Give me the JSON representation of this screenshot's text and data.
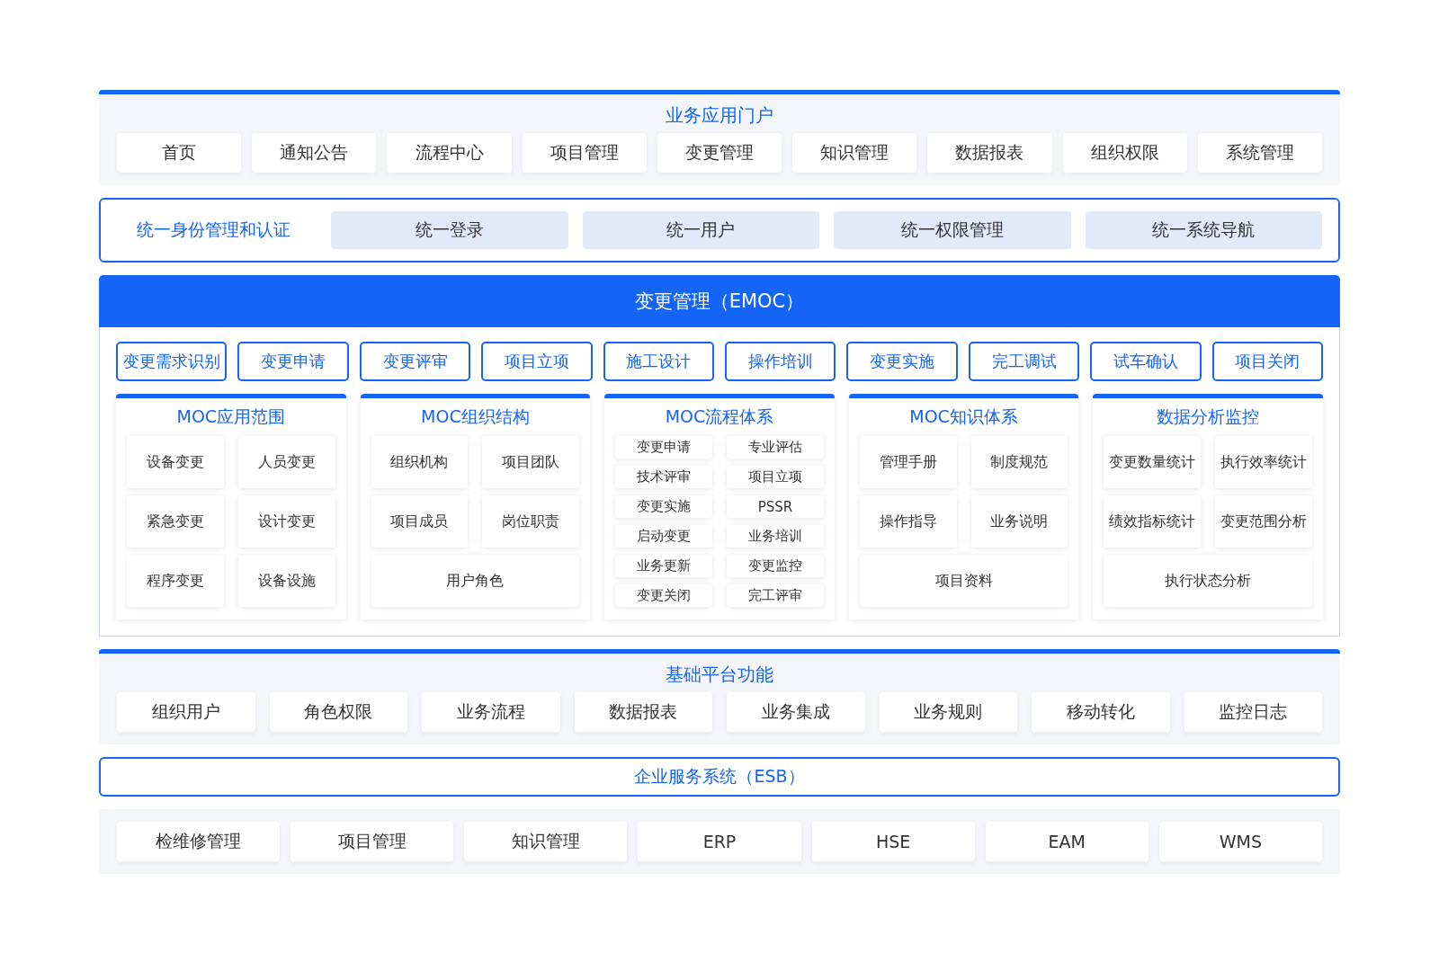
{
  "portal": {
    "title": "业务应用门户",
    "items": [
      "首页",
      "通知公告",
      "流程中心",
      "项目管理",
      "变更管理",
      "知识管理",
      "数据报表",
      "组织权限",
      "系统管理"
    ]
  },
  "identity": {
    "label": "统一身份管理和认证",
    "items": [
      "统一登录",
      "统一用户",
      "统一权限管理",
      "统一系统导航"
    ]
  },
  "emoc": {
    "title": "变更管理（EMOC）",
    "steps": [
      "变更需求识别",
      "变更申请",
      "变更评审",
      "项目立项",
      "施工设计",
      "操作培训",
      "变更实施",
      "完工调试",
      "试车确认",
      "项目关闭"
    ],
    "modules": [
      {
        "title": "MOC应用范围",
        "kind": "tiles",
        "items": [
          "设备变更",
          "人员变更",
          "紧急变更",
          "设计变更",
          "程序变更",
          "设备设施"
        ]
      },
      {
        "title": "MOC组织结构",
        "kind": "tiles",
        "items": [
          "组织机构",
          "项目团队",
          "项目成员",
          "岗位职责",
          "用户角色"
        ]
      },
      {
        "title": "MOC流程体系",
        "kind": "compact",
        "items": [
          "变更申请",
          "专业评估",
          "技术评审",
          "项目立项",
          "变更实施",
          "PSSR",
          "启动变更",
          "业务培训",
          "业务更新",
          "变更监控",
          "变更关闭",
          "完工评审"
        ]
      },
      {
        "title": "MOC知识体系",
        "kind": "tiles",
        "items": [
          "管理手册",
          "制度规范",
          "操作指导",
          "业务说明",
          "项目资料"
        ]
      },
      {
        "title": "数据分析监控",
        "kind": "tiles",
        "items": [
          "变更数量统计",
          "执行效率统计",
          "绩效指标统计",
          "变更范围分析",
          "执行状态分析"
        ]
      }
    ]
  },
  "platform": {
    "title": "基础平台功能",
    "items": [
      "组织用户",
      "角色权限",
      "业务流程",
      "数据报表",
      "业务集成",
      "业务规则",
      "移动转化",
      "监控日志"
    ]
  },
  "esb": {
    "title": "企业服务系统（ESB）"
  },
  "systems": {
    "items": [
      "检维修管理",
      "项目管理",
      "知识管理",
      "ERP",
      "HSE",
      "EAM",
      "WMS"
    ]
  }
}
